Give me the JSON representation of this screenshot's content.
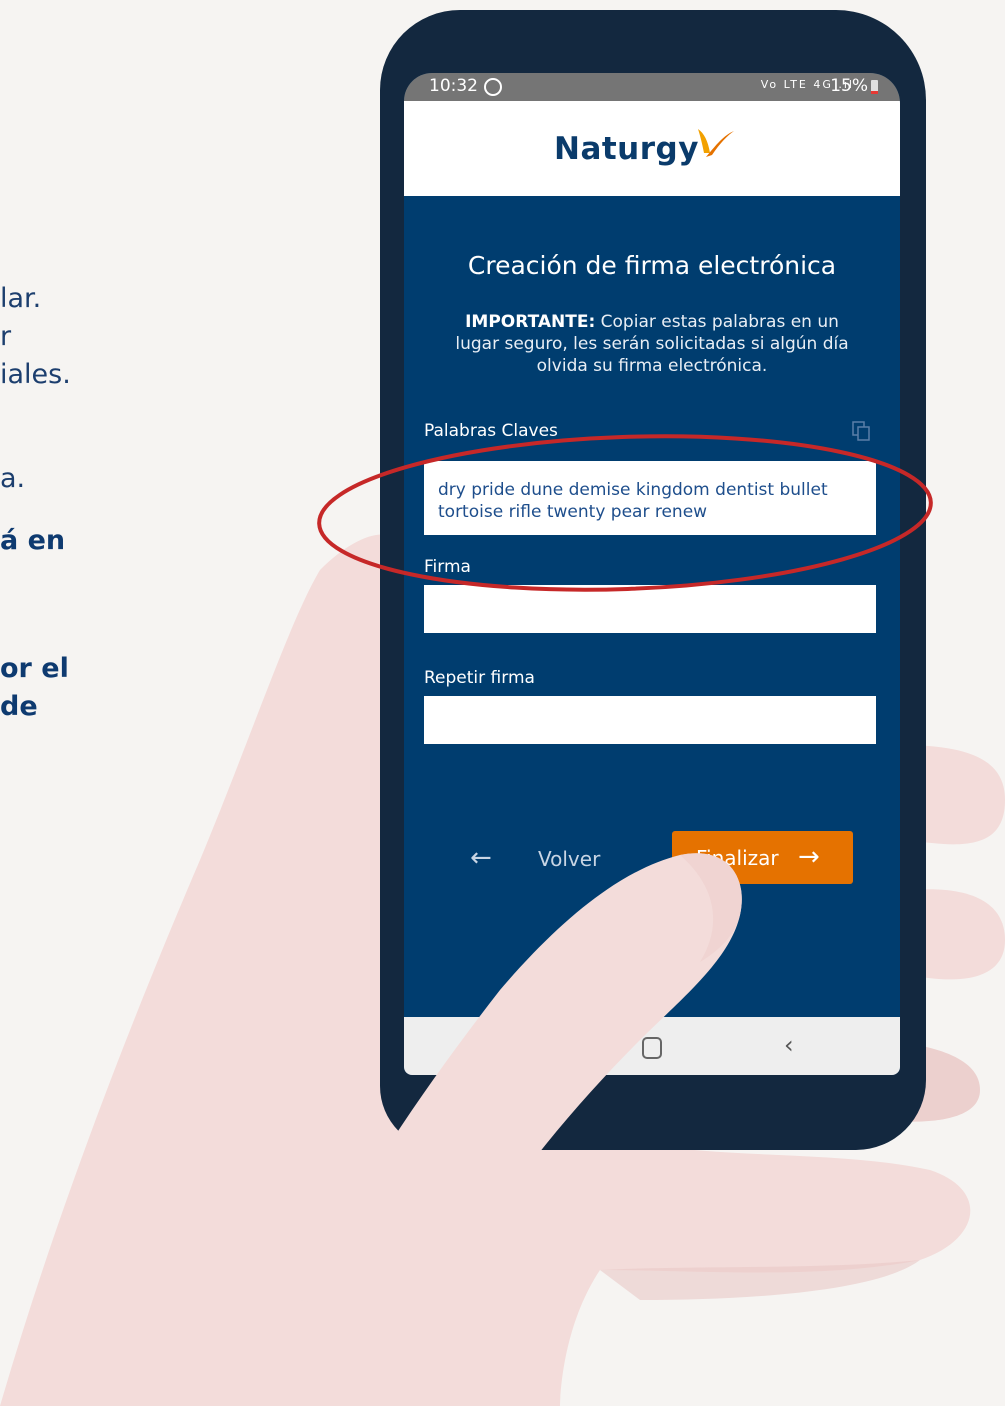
{
  "side_text": {
    "line1": "lar.",
    "line2": "r",
    "line3": "iales.",
    "line4": "a.",
    "line5": "á en",
    "line6": "or el",
    "line7": "de"
  },
  "status_bar": {
    "time": "10:32",
    "network_icons": "Vo LTE 4G .ıl",
    "battery": "15%"
  },
  "header": {
    "logo_text": "Naturgy"
  },
  "page": {
    "title": "Creación de firma electrónica",
    "important_label": "IMPORTANTE:",
    "important_text": " Copiar estas palabras en un lugar seguro, les serán solicitadas si algún día olvida su firma electrónica."
  },
  "form": {
    "keywords_label": "Palabras Claves",
    "keywords_value": "dry pride dune demise kingdom dentist bullet tortoise rifle twenty pear renew",
    "signature_label": "Firma",
    "signature_value": "",
    "repeat_label": "Repetir firma",
    "repeat_value": ""
  },
  "buttons": {
    "back_arrow": "←",
    "back_label": "Volver",
    "finish_label": "Finalizar",
    "finish_arrow": "→"
  },
  "nav_bar": {
    "back_glyph": "‹"
  },
  "colors": {
    "background": "#f6f4f2",
    "screen_blue": "#003d6f",
    "accent_orange": "#e57200",
    "highlight_red": "#c62828",
    "hand": "#f3dcda"
  },
  "icons": [
    "whatsapp-icon",
    "signal-icon",
    "battery-icon",
    "copy-icon",
    "arrow-left-icon",
    "arrow-right-icon",
    "home-icon",
    "back-nav-icon",
    "naturgy-logo-mark"
  ]
}
